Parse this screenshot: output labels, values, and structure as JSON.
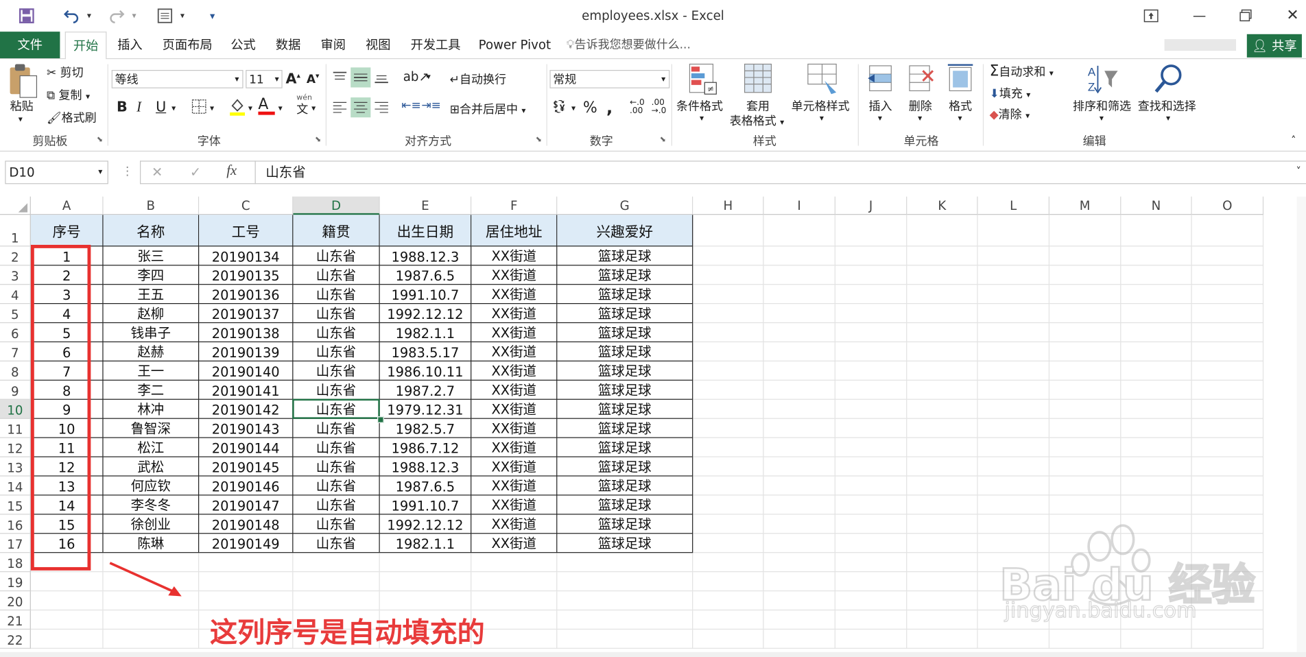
{
  "window": {
    "title": "employees.xlsx - Excel",
    "controls": [
      "restore-ribbon",
      "minimize",
      "maximize",
      "close"
    ]
  },
  "quick_access": {
    "save_icon": "save-icon",
    "undo_icon": "undo-icon",
    "redo_icon": "redo-icon",
    "form_icon": "form-icon"
  },
  "tabs": {
    "file": "文件",
    "home": "开始",
    "insert": "插入",
    "layout": "页面布局",
    "formulas": "公式",
    "data": "数据",
    "review": "审阅",
    "view": "视图",
    "developer": "开发工具",
    "powerpivot": "Power Pivot",
    "tellme": "告诉我您想要做什么...",
    "share": "共享"
  },
  "ribbon": {
    "clipboard": {
      "label": "剪贴板",
      "paste": "粘贴",
      "cut": "剪切",
      "copy": "复制",
      "format_painter": "格式刷"
    },
    "font": {
      "label": "字体",
      "name": "等线",
      "size": "11",
      "bold": "B",
      "italic": "I",
      "underline": "U",
      "wen": "wén",
      "wen_char": "文"
    },
    "alignment": {
      "label": "对齐方式",
      "wrap": "自动换行",
      "merge": "合并后居中"
    },
    "number": {
      "label": "数字",
      "format": "常规",
      "percent": "%",
      "comma": ","
    },
    "styles": {
      "label": "样式",
      "conditional": "条件格式",
      "table_format_1": "套用",
      "table_format_2": "表格格式",
      "cell_styles": "单元格样式"
    },
    "cells": {
      "label": "单元格",
      "insert": "插入",
      "delete": "删除",
      "format": "格式"
    },
    "editing": {
      "label": "编辑",
      "autosum": "自动求和",
      "fill": "填充",
      "clear": "清除",
      "sort": "排序和筛选",
      "find": "查找和选择"
    }
  },
  "formula_bar": {
    "name_box": "D10",
    "cancel": "✕",
    "enter": "✓",
    "fx": "fx",
    "content": "山东省"
  },
  "columns": [
    "A",
    "B",
    "C",
    "D",
    "E",
    "F",
    "G",
    "H",
    "I",
    "J",
    "K",
    "L",
    "M",
    "N",
    "O"
  ],
  "rows": [
    "1",
    "2",
    "3",
    "4",
    "5",
    "6",
    "7",
    "8",
    "9",
    "10",
    "11",
    "12",
    "13",
    "14",
    "15",
    "16",
    "17",
    "18",
    "19",
    "20",
    "21",
    "22"
  ],
  "table": {
    "headers": [
      "序号",
      "名称",
      "工号",
      "籍贯",
      "出生日期",
      "居住地址",
      "兴趣爱好"
    ],
    "rows": [
      [
        "1",
        "张三",
        "20190134",
        "山东省",
        "1988.12.3",
        "XX街道",
        "篮球足球"
      ],
      [
        "2",
        "李四",
        "20190135",
        "山东省",
        "1987.6.5",
        "XX街道",
        "篮球足球"
      ],
      [
        "3",
        "王五",
        "20190136",
        "山东省",
        "1991.10.7",
        "XX街道",
        "篮球足球"
      ],
      [
        "4",
        "赵柳",
        "20190137",
        "山东省",
        "1992.12.12",
        "XX街道",
        "篮球足球"
      ],
      [
        "5",
        "钱串子",
        "20190138",
        "山东省",
        "1982.1.1",
        "XX街道",
        "篮球足球"
      ],
      [
        "6",
        "赵赫",
        "20190139",
        "山东省",
        "1983.5.17",
        "XX街道",
        "篮球足球"
      ],
      [
        "7",
        "王一",
        "20190140",
        "山东省",
        "1986.10.11",
        "XX街道",
        "篮球足球"
      ],
      [
        "8",
        "李二",
        "20190141",
        "山东省",
        "1987.2.7",
        "XX街道",
        "篮球足球"
      ],
      [
        "9",
        "林冲",
        "20190142",
        "山东省",
        "1979.12.31",
        "XX街道",
        "篮球足球"
      ],
      [
        "10",
        "鲁智深",
        "20190143",
        "山东省",
        "1982.5.7",
        "XX街道",
        "篮球足球"
      ],
      [
        "11",
        "松江",
        "20190144",
        "山东省",
        "1986.7.12",
        "XX街道",
        "篮球足球"
      ],
      [
        "12",
        "武松",
        "20190145",
        "山东省",
        "1988.12.3",
        "XX街道",
        "篮球足球"
      ],
      [
        "13",
        "何应钦",
        "20190146",
        "山东省",
        "1987.6.5",
        "XX街道",
        "篮球足球"
      ],
      [
        "14",
        "李冬冬",
        "20190147",
        "山东省",
        "1991.10.7",
        "XX街道",
        "篮球足球"
      ],
      [
        "15",
        "徐创业",
        "20190148",
        "山东省",
        "1992.12.12",
        "XX街道",
        "篮球足球"
      ],
      [
        "16",
        "陈琳",
        "20190149",
        "山东省",
        "1982.1.1",
        "XX街道",
        "篮球足球"
      ]
    ]
  },
  "selected_cell": "D10",
  "annotation": {
    "text": "这列序号是自动填充的",
    "color": "#e83b3b"
  },
  "watermark": {
    "brand": "Bai du 经验",
    "url": "jingyan.baidu.com"
  },
  "colors": {
    "excel_green": "#217346",
    "header_fill": "#ddebf7",
    "annotation_red": "#e8312f"
  }
}
